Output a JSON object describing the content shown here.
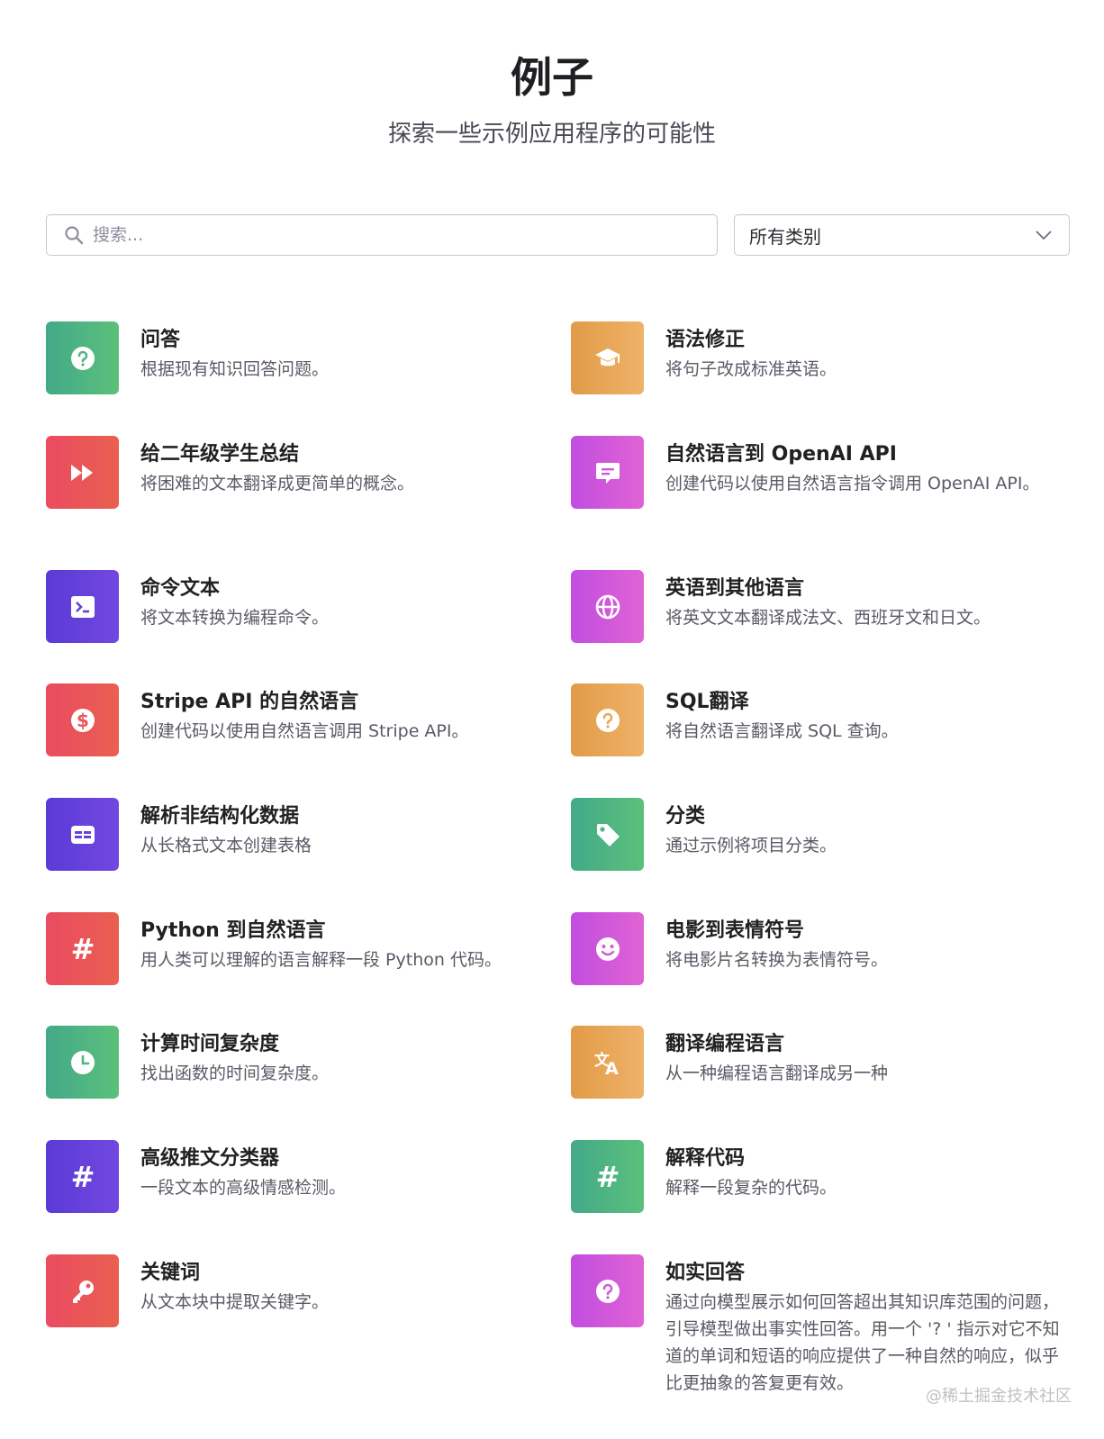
{
  "header": {
    "title": "例子",
    "subtitle": "探索一些示例应用程序的可能性"
  },
  "search": {
    "placeholder": "搜索...",
    "value": ""
  },
  "category_filter": {
    "selected": "所有类别"
  },
  "examples": [
    {
      "title": "问答",
      "description": "根据现有知识回答问题。",
      "icon": "question-icon",
      "color": "green"
    },
    {
      "title": "语法修正",
      "description": "将句子改成标准英语。",
      "icon": "graduation-cap-icon",
      "color": "orange"
    },
    {
      "title": "给二年级学生总结",
      "description": "将困难的文本翻译成更简单的概念。",
      "icon": "fast-forward-icon",
      "color": "red"
    },
    {
      "title": "自然语言到 OpenAI API",
      "description": "创建代码以使用自然语言指令调用 OpenAI API。",
      "icon": "chat-bubble-icon",
      "color": "magenta"
    },
    {
      "title": "命令文本",
      "description": "将文本转换为编程命令。",
      "icon": "terminal-icon",
      "color": "purple"
    },
    {
      "title": "英语到其他语言",
      "description": "将英文文本翻译成法文、西班牙文和日文。",
      "icon": "globe-icon",
      "color": "magenta"
    },
    {
      "title": "Stripe API 的自然语言",
      "description": "创建代码以使用自然语言调用 Stripe API。",
      "icon": "dollar-icon",
      "color": "red"
    },
    {
      "title": "SQL翻译",
      "description": "将自然语言翻译成 SQL 查询。",
      "icon": "question-icon",
      "color": "orange"
    },
    {
      "title": "解析非结构化数据",
      "description": "从长格式文本创建表格",
      "icon": "table-icon",
      "color": "purple"
    },
    {
      "title": "分类",
      "description": "通过示例将项目分类。",
      "icon": "tag-icon",
      "color": "green"
    },
    {
      "title": "Python 到自然语言",
      "description": "用人类可以理解的语言解释一段 Python 代码。",
      "icon": "hash-icon",
      "color": "red"
    },
    {
      "title": "电影到表情符号",
      "description": "将电影片名转换为表情符号。",
      "icon": "smiley-icon",
      "color": "magenta"
    },
    {
      "title": "计算时间复杂度",
      "description": "找出函数的时间复杂度。",
      "icon": "clock-icon",
      "color": "green"
    },
    {
      "title": "翻译编程语言",
      "description": "从一种编程语言翻译成另一种",
      "icon": "translate-icon",
      "color": "orange"
    },
    {
      "title": "高级推文分类器",
      "description": "一段文本的高级情感检测。",
      "icon": "hash-icon",
      "color": "purple"
    },
    {
      "title": "解释代码",
      "description": "解释一段复杂的代码。",
      "icon": "hash-icon",
      "color": "green"
    },
    {
      "title": "关键词",
      "description": "从文本块中提取关键字。",
      "icon": "key-icon",
      "color": "red"
    },
    {
      "title": "如实回答",
      "description": "通过向模型展示如何回答超出其知识库范围的问题，引导模型做出事实性回答。用一个 '? ' 指示对它不知道的单词和短语的响应提供了一种自然的响应，似乎比更抽象的答复更有效。",
      "icon": "question-icon",
      "color": "magenta"
    }
  ],
  "colors": {
    "green": "#4fb583",
    "orange": "#e8a75a",
    "red": "#e95659",
    "magenta": "#d15ad9",
    "purple": "#6342da"
  },
  "watermark": "@稀土掘金技术社区"
}
